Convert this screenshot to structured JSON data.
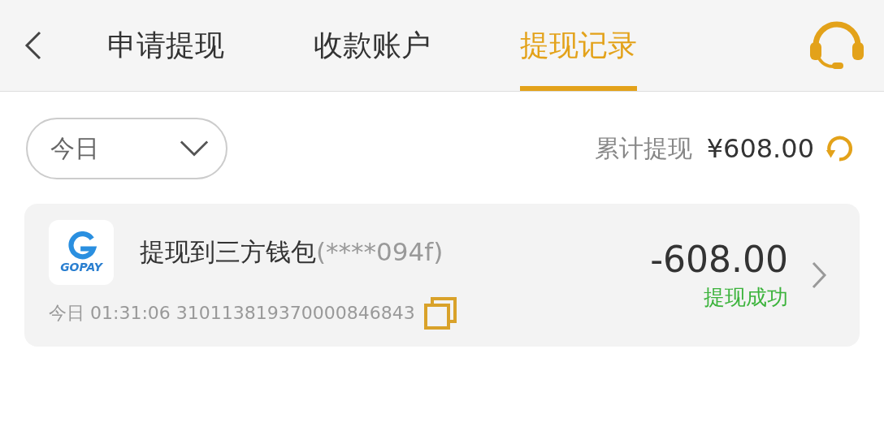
{
  "header": {
    "tabs": [
      {
        "label": "申请提现",
        "selected": false
      },
      {
        "label": "收款账户",
        "selected": false
      },
      {
        "label": "提现记录",
        "selected": true
      }
    ]
  },
  "filter": {
    "value": "今日"
  },
  "total": {
    "label": "累计提现",
    "amount": "¥608.00"
  },
  "records": [
    {
      "logo_text": "GOPAY",
      "title": "提现到三方钱包",
      "account": "(****094f)",
      "meta": "今日 01:31:06 310113819370000846843",
      "amount": "-608.00",
      "status": {
        "label": "提现成功",
        "color": "#3cb33c"
      }
    }
  ]
}
